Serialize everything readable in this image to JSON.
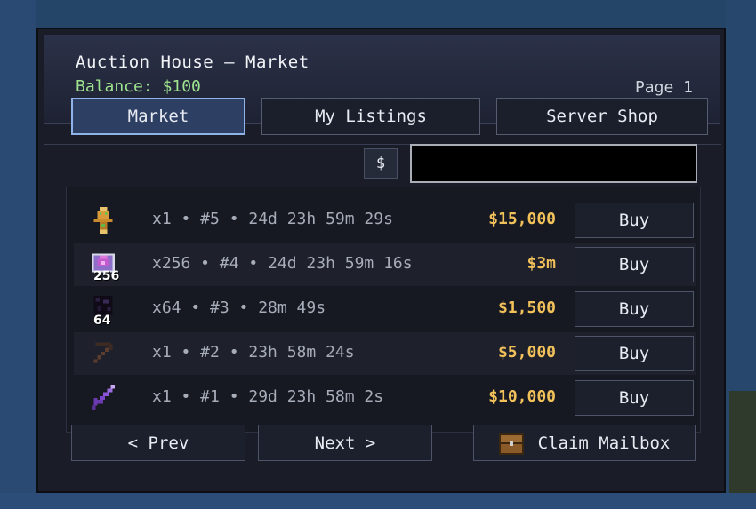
{
  "header": {
    "title": "Auction House — Market",
    "balance": "Balance: $100",
    "page": "Page 1"
  },
  "tabs": [
    {
      "label": "Market",
      "active": true
    },
    {
      "label": "My Listings",
      "active": false
    },
    {
      "label": "Server Shop",
      "active": false
    }
  ],
  "filter": {
    "label": "$"
  },
  "search": {
    "value": ""
  },
  "listings": [
    {
      "icon": "totem-icon",
      "count": "",
      "info": "x1 • #5 • 24d 23h 59m 29s",
      "price": "$15,000",
      "buy": "Buy"
    },
    {
      "icon": "enchanted-crystal-icon",
      "count": "256",
      "info": "x256 • #4 • 24d 23h 59m 16s",
      "price": "$3m",
      "buy": "Buy"
    },
    {
      "icon": "obsidian-icon",
      "count": "64",
      "info": "x64 • #3 • 28m 49s",
      "price": "$1,500",
      "buy": "Buy"
    },
    {
      "icon": "pickaxe-icon",
      "count": "",
      "info": "x1 • #2 • 23h 58m 24s",
      "price": "$5,000",
      "buy": "Buy"
    },
    {
      "icon": "enchanted-sword-icon",
      "count": "",
      "info": "x1 • #1 • 29d 23h 58m 2s",
      "price": "$10,000",
      "buy": "Buy"
    }
  ],
  "footer": {
    "prev": "< Prev",
    "next": "Next >",
    "mailbox": "Claim Mailbox"
  },
  "colors": {
    "price": "#f2c15a",
    "balance": "#9fe58f",
    "active_tab_border": "#8fb2e8"
  }
}
